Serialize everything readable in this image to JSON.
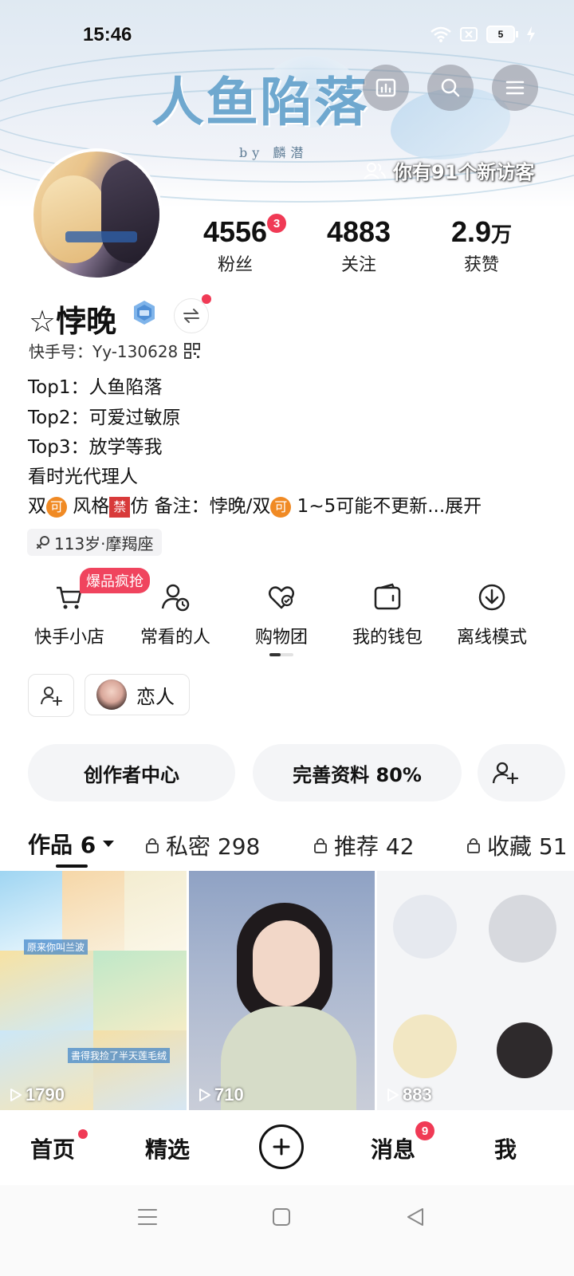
{
  "status_bar": {
    "time": "15:46",
    "battery": "5"
  },
  "banner": {
    "title": "人鱼陷落",
    "subtitle": "by 麟潜"
  },
  "visitor": {
    "text": "你有91个新访客"
  },
  "stats": [
    {
      "value": "4556",
      "unit": "",
      "label": "粉丝",
      "badge": "3"
    },
    {
      "value": "4883",
      "unit": "",
      "label": "关注",
      "badge": ""
    },
    {
      "value": "2.9",
      "unit": "万",
      "label": "获赞",
      "badge": ""
    }
  ],
  "profile": {
    "name": "☆悖晚",
    "kuaishou_id": "快手号：Yy-130628",
    "bio": [
      "Top1：人鱼陷落",
      "Top2：可爱过敏原",
      "Top3：放学等我",
      "看时光代理人"
    ],
    "bio_last": {
      "p1": "双",
      "tag1": "可",
      "p2": " 风格",
      "tag2": "禁",
      "p3": "仿 备注：悖晚/双",
      "tag3": "可",
      "p4": " 1~5可能不更新...",
      "expand": "展开"
    },
    "age_constellation": "113岁·摩羯座"
  },
  "tools": {
    "hot_badge": "爆品疯抢",
    "items": [
      {
        "label": "快手小店",
        "icon": "cart-icon"
      },
      {
        "label": "常看的人",
        "icon": "person-clock-icon"
      },
      {
        "label": "购物团",
        "icon": "heart-bag-icon"
      },
      {
        "label": "我的钱包",
        "icon": "wallet-icon"
      },
      {
        "label": "离线模式",
        "icon": "download-icon"
      }
    ]
  },
  "relation": {
    "label": "恋人"
  },
  "actions": {
    "creator_center": "创作者中心",
    "complete_profile": "完善资料 80%"
  },
  "content_tabs": [
    {
      "label": "作品 6",
      "locked": false,
      "active": true
    },
    {
      "label": "私密 298",
      "locked": true,
      "active": false
    },
    {
      "label": "推荐 42",
      "locked": true,
      "active": false
    },
    {
      "label": "收藏 51",
      "locked": true,
      "active": false
    }
  ],
  "thumbnails": [
    {
      "plays": "1790",
      "captions": [
        "原来你叫兰波",
        "書得我捡了半天莲毛绒"
      ]
    },
    {
      "plays": "710",
      "captions": []
    },
    {
      "plays": "883",
      "captions": []
    }
  ],
  "bottom_nav": [
    {
      "label": "首页",
      "dot": true,
      "badge": ""
    },
    {
      "label": "精选",
      "dot": false,
      "badge": ""
    },
    {
      "label": "消息",
      "dot": false,
      "badge": "9"
    },
    {
      "label": "我",
      "dot": false,
      "badge": ""
    }
  ],
  "colors": {
    "accent_red": "#f03a55",
    "orange_tag": "#f08a24",
    "banner_title": "#6fa8cf"
  }
}
